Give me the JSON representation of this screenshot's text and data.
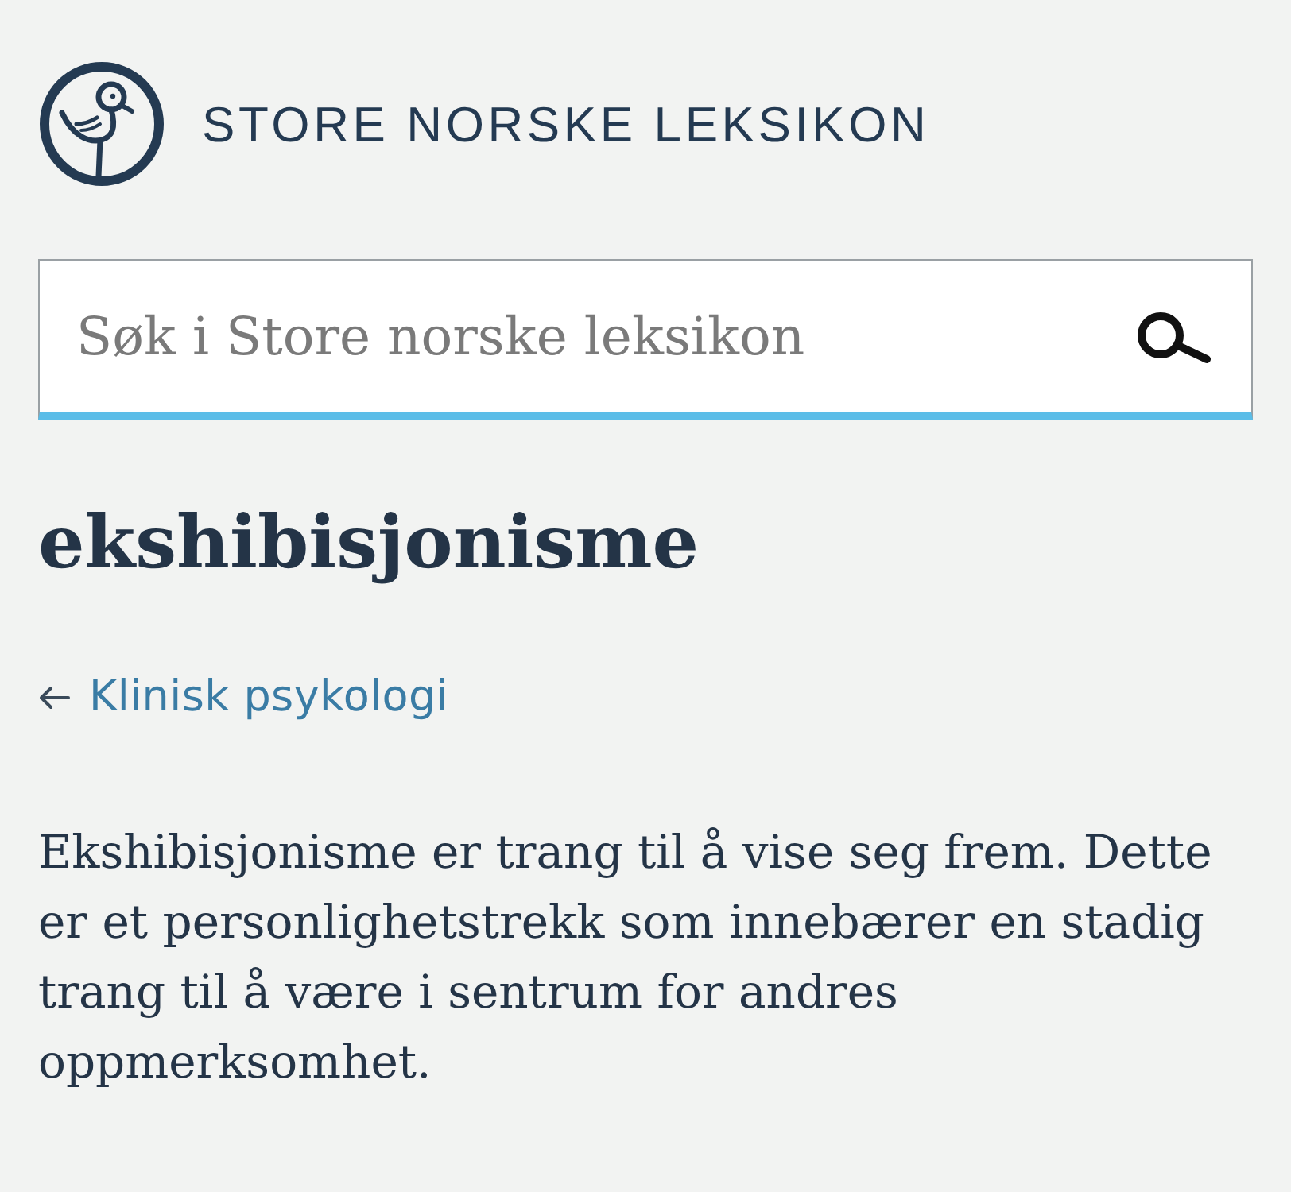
{
  "header": {
    "site_title": "STORE NORSKE LEKSIKON"
  },
  "search": {
    "placeholder": "Søk i Store norske leksikon"
  },
  "article": {
    "title": "ekshibisjonisme",
    "breadcrumb": {
      "label": "Klinisk psykologi"
    },
    "summary": "Ekshibisjonisme er trang til å vise seg frem. Dette er et personlighetstrekk som innebærer en stadig trang til å være i sentrum for andres oppmerksomhet."
  }
}
